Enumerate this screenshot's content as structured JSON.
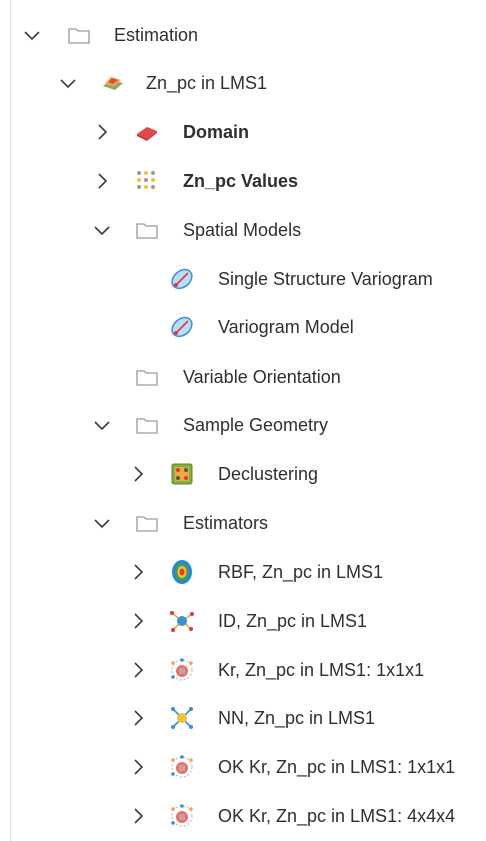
{
  "tree": {
    "root": {
      "label": "Estimation",
      "icon": "folder-icon",
      "expanded": true
    },
    "estimation": {
      "label": "Zn_pc in LMS1",
      "icon": "geo-model-icon",
      "expanded": true
    },
    "domain": {
      "label": "Domain",
      "icon": "domain-icon",
      "expanded": false
    },
    "values": {
      "label": "Zn_pc Values",
      "icon": "points-icon",
      "expanded": false
    },
    "spatial": {
      "label": "Spatial Models",
      "icon": "folder-icon",
      "expanded": true
    },
    "variogram1": {
      "label": "Single Structure Variogram",
      "icon": "variogram-icon"
    },
    "variogram2": {
      "label": "Variogram Model",
      "icon": "variogram-icon"
    },
    "orientation": {
      "label": "Variable Orientation",
      "icon": "folder-icon"
    },
    "sample_geometry": {
      "label": "Sample Geometry",
      "icon": "folder-icon",
      "expanded": true
    },
    "declustering": {
      "label": "Declustering",
      "icon": "declustering-icon",
      "expanded": false
    },
    "estimators": {
      "label": "Estimators",
      "icon": "folder-icon",
      "expanded": true
    },
    "est_rbf": {
      "label": "RBF, Zn_pc in LMS1",
      "icon": "rbf-icon"
    },
    "est_id": {
      "label": "ID, Zn_pc in LMS1",
      "icon": "id-icon"
    },
    "est_kr": {
      "label": "Kr, Zn_pc in LMS1: 1x1x1",
      "icon": "kriging-icon"
    },
    "est_nn": {
      "label": "NN, Zn_pc in LMS1",
      "icon": "nn-icon"
    },
    "est_ok1": {
      "label": "OK Kr, Zn_pc in LMS1: 1x1x1",
      "icon": "kriging-icon"
    },
    "est_ok4": {
      "label": "OK Kr, Zn_pc in LMS1: 4x4x4",
      "icon": "kriging-icon"
    }
  },
  "colors": {
    "chevron": "#3a3a3a",
    "folder_stroke": "#9a9a9a",
    "domain_red": "#e2484b",
    "variogram_blue": "#3a8fd6",
    "variogram_fill": "#b9def7",
    "accent_red": "#e53935"
  }
}
